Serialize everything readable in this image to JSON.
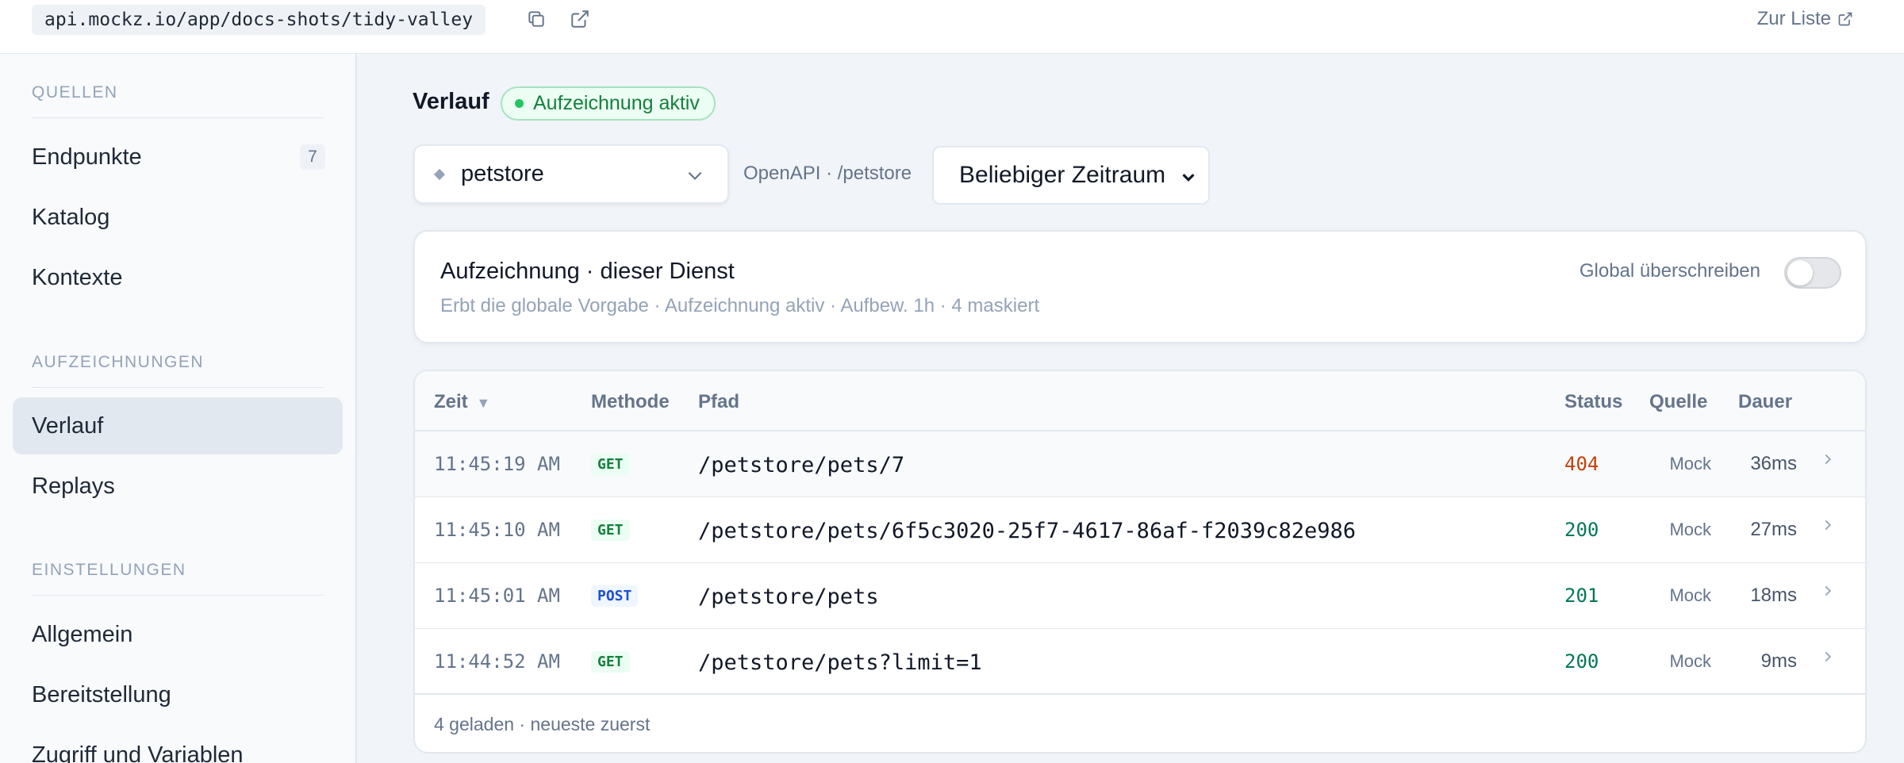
{
  "topbar": {
    "url": "api.mockz.io/app/docs-shots/tidy-valley",
    "copy_icon": "copy-icon",
    "open_icon": "external-link-icon",
    "back_link": "Zur Liste"
  },
  "sidebar": {
    "sections": [
      {
        "title": "QUELLEN",
        "items": [
          {
            "label": "Endpunkte",
            "badge": "7"
          },
          {
            "label": "Katalog"
          },
          {
            "label": "Kontexte"
          }
        ]
      },
      {
        "title": "AUFZEICHNUNGEN",
        "items": [
          {
            "label": "Verlauf",
            "active": true
          },
          {
            "label": "Replays"
          }
        ]
      },
      {
        "title": "EINSTELLUNGEN",
        "items": [
          {
            "label": "Allgemein"
          },
          {
            "label": "Bereitstellung"
          },
          {
            "label": "Zugriff und Variablen"
          }
        ]
      }
    ]
  },
  "main": {
    "title": "Verlauf",
    "rec_badge": "Aufzeichnung aktiv",
    "service": "petstore",
    "service_meta": "OpenAPI · /petstore",
    "time_range": "Beliebiger Zeitraum",
    "recording_card": {
      "title": "Aufzeichnung · dieser Dienst",
      "subtitle": "Erbt die globale Vorgabe · Aufzeichnung aktiv · Aufbew. 1h · 4 maskiert",
      "override_label": "Global überschreiben",
      "override_on": false
    },
    "table": {
      "headers": {
        "time": "Zeit",
        "method": "Methode",
        "path": "Pfad",
        "status": "Status",
        "source": "Quelle",
        "duration": "Dauer"
      },
      "sort_indicator": "▼",
      "rows": [
        {
          "time": "11:45:19 AM",
          "method": "GET",
          "path": "/petstore/pets/7",
          "status": "404",
          "source": "Mock",
          "duration": "36ms"
        },
        {
          "time": "11:45:10 AM",
          "method": "GET",
          "path": "/petstore/pets/6f5c3020-25f7-4617-86af-f2039c82e986",
          "status": "200",
          "source": "Mock",
          "duration": "27ms"
        },
        {
          "time": "11:45:01 AM",
          "method": "POST",
          "path": "/petstore/pets",
          "status": "201",
          "source": "Mock",
          "duration": "18ms"
        },
        {
          "time": "11:44:52 AM",
          "method": "GET",
          "path": "/petstore/pets?limit=1",
          "status": "200",
          "source": "Mock",
          "duration": "9ms"
        }
      ],
      "footer": "4 geladen · neueste zuerst"
    }
  },
  "colors": {
    "status_404": "#c2410c",
    "status_2xx": "#047857",
    "accent_green": "#22c55e"
  }
}
